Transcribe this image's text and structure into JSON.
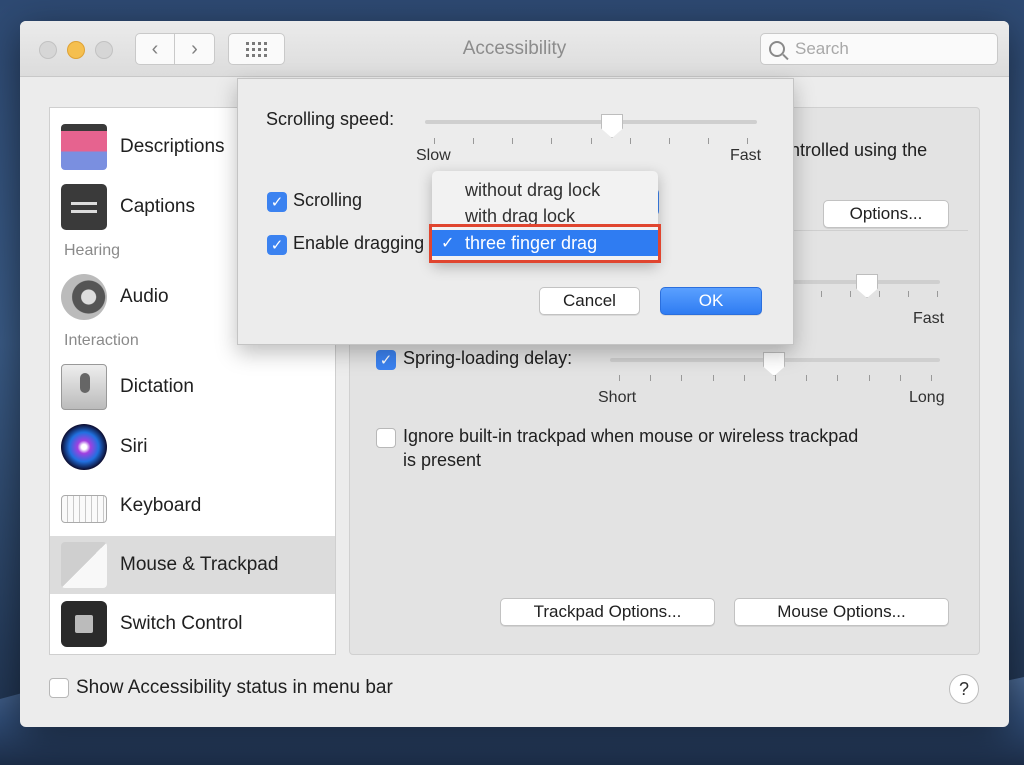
{
  "window": {
    "title": "Accessibility"
  },
  "search": {
    "placeholder": "Search"
  },
  "sidebar": {
    "items": [
      {
        "label": "Descriptions"
      },
      {
        "label": "Captions"
      },
      {
        "label": "Audio"
      },
      {
        "label": "Dictation"
      },
      {
        "label": "Siri"
      },
      {
        "label": "Keyboard"
      },
      {
        "label": "Mouse & Trackpad"
      },
      {
        "label": "Switch Control"
      }
    ],
    "headers": {
      "hearing": "Hearing",
      "interaction": "Interaction"
    }
  },
  "main": {
    "partial_text": "ntrolled using the",
    "options_label": "Options...",
    "speed_fast": "Fast",
    "spring_loading_label": "Spring-loading delay:",
    "spring_short": "Short",
    "spring_long": "Long",
    "ignore_trackpad_line1": "Ignore built-in trackpad when mouse or wireless trackpad",
    "ignore_trackpad_line2": "is present",
    "trackpad_options_label": "Trackpad Options...",
    "mouse_options_label": "Mouse Options..."
  },
  "sheet": {
    "scrolling_speed_label": "Scrolling speed:",
    "slow": "Slow",
    "fast": "Fast",
    "scrolling_label": "Scrolling",
    "enable_dragging_label": "Enable dragging",
    "cancel_label": "Cancel",
    "ok_label": "OK"
  },
  "menu": {
    "options": [
      "without drag lock",
      "with drag lock",
      "three finger drag"
    ],
    "selected": "three finger drag"
  },
  "footer": {
    "show_status_label": "Show Accessibility status in menu bar",
    "help_label": "?"
  },
  "colors": {
    "accent": "#3b82f0",
    "highlight_box": "#e0452f"
  }
}
